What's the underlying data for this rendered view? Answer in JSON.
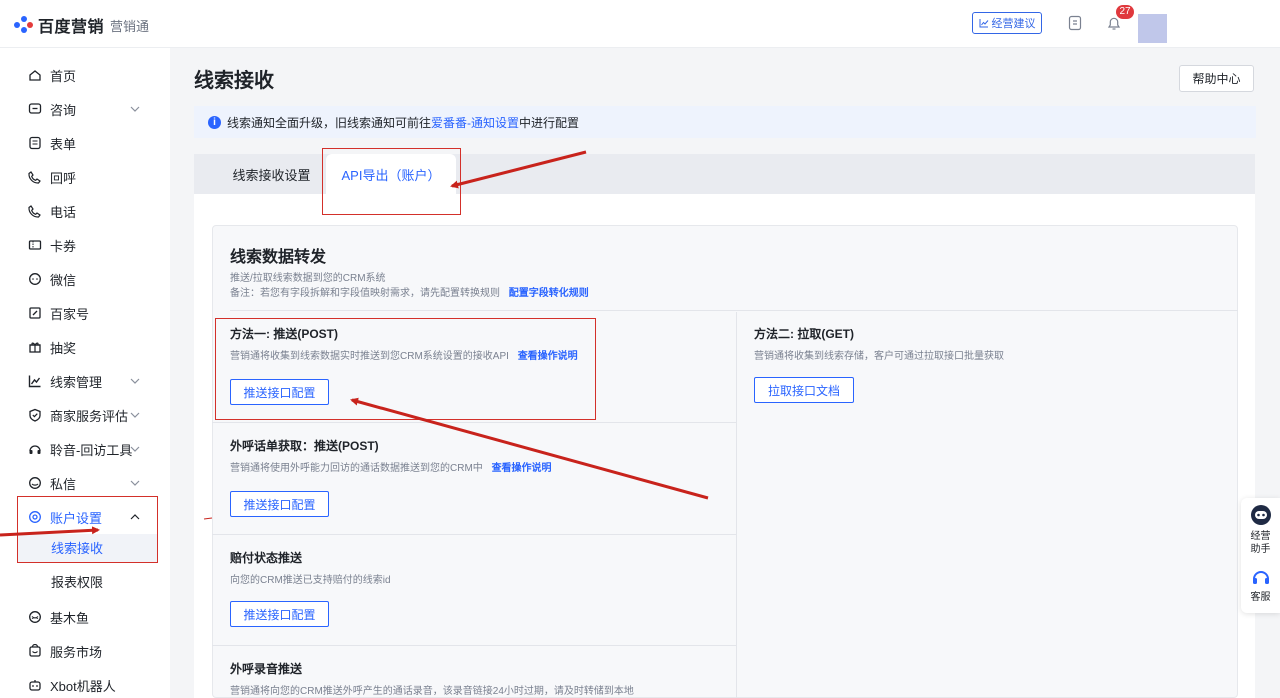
{
  "topbar": {
    "brand": "百度营销",
    "product": "营销通",
    "suggest_label": "经营建议",
    "notification_count": "27"
  },
  "sidebar": {
    "items": [
      {
        "label": "首页",
        "icon": "home-icon"
      },
      {
        "label": "咨询",
        "icon": "chat-icon",
        "expandable": true
      },
      {
        "label": "表单",
        "icon": "form-icon"
      },
      {
        "label": "回呼",
        "icon": "callback-icon"
      },
      {
        "label": "电话",
        "icon": "phone-icon"
      },
      {
        "label": "卡券",
        "icon": "coupon-icon"
      },
      {
        "label": "微信",
        "icon": "wechat-icon"
      },
      {
        "label": "百家号",
        "icon": "baijiahao-icon"
      },
      {
        "label": "抽奖",
        "icon": "gift-icon"
      },
      {
        "label": "线索管理",
        "icon": "chart-icon",
        "expandable": true
      },
      {
        "label": "商家服务评估",
        "icon": "shield-icon",
        "expandable": true
      },
      {
        "label": "聆音-回访工具",
        "icon": "headset-icon",
        "expandable": true
      },
      {
        "label": "私信",
        "icon": "message-icon",
        "expandable": true
      },
      {
        "label": "账户设置",
        "icon": "settings-icon",
        "expandable": true,
        "expanded": true
      },
      {
        "label": "基木鱼",
        "icon": "fish-icon"
      },
      {
        "label": "服务市场",
        "icon": "market-icon"
      },
      {
        "label": "Xbot机器人",
        "icon": "robot-icon"
      }
    ],
    "sub_items": [
      {
        "label": "线索接收",
        "active": true
      },
      {
        "label": "报表权限",
        "active": false
      }
    ]
  },
  "main": {
    "title": "线索接收",
    "help_label": "帮助中心",
    "notice": {
      "prefix": "线索通知全面升级，旧线索通知可前往",
      "link": "爱番番-通知设置",
      "suffix": "中进行配置"
    },
    "tabs": [
      {
        "label": "线索接收设置",
        "active": false
      },
      {
        "label": "API导出（账户）",
        "active": true
      }
    ],
    "section": {
      "title": "线索数据转发",
      "desc1": "推送/拉取线索数据到您的CRM系统",
      "desc2": "备注：若您有字段拆解和字段值映射需求，请先配置转换规则",
      "desc2_link": "配置字段转化规则"
    },
    "methods": [
      {
        "title": "方法一: 推送(POST)",
        "desc": "营销通将收集到线索数据实时推送到您CRM系统设置的接收API",
        "link": "查看操作说明",
        "button": "推送接口配置"
      },
      {
        "title": "方法二: 拉取(GET)",
        "desc": "营销通将收集到线索存储，客户可通过拉取接口批量获取",
        "button": "拉取接口文档"
      },
      {
        "title": "外呼话单获取：推送(POST)",
        "desc": "营销通将使用外呼能力回访的通话数据推送到您的CRM中",
        "link": "查看操作说明",
        "button": "推送接口配置"
      },
      {
        "title": "赔付状态推送",
        "desc": "向您的CRM推送已支持赔付的线索id",
        "button": "推送接口配置"
      },
      {
        "title": "外呼录音推送",
        "desc": "营销通将向您的CRM推送外呼产生的通话录音，该录音链接24小时过期，请及时转储到本地"
      }
    ]
  },
  "float": {
    "assistant_label": "经营\n助手",
    "assistant_line1": "经营",
    "assistant_line2": "助手",
    "service_label": "客服"
  },
  "colors": {
    "accent": "#2a64ff",
    "annotation": "#d3302a",
    "badge": "#e0393e"
  }
}
